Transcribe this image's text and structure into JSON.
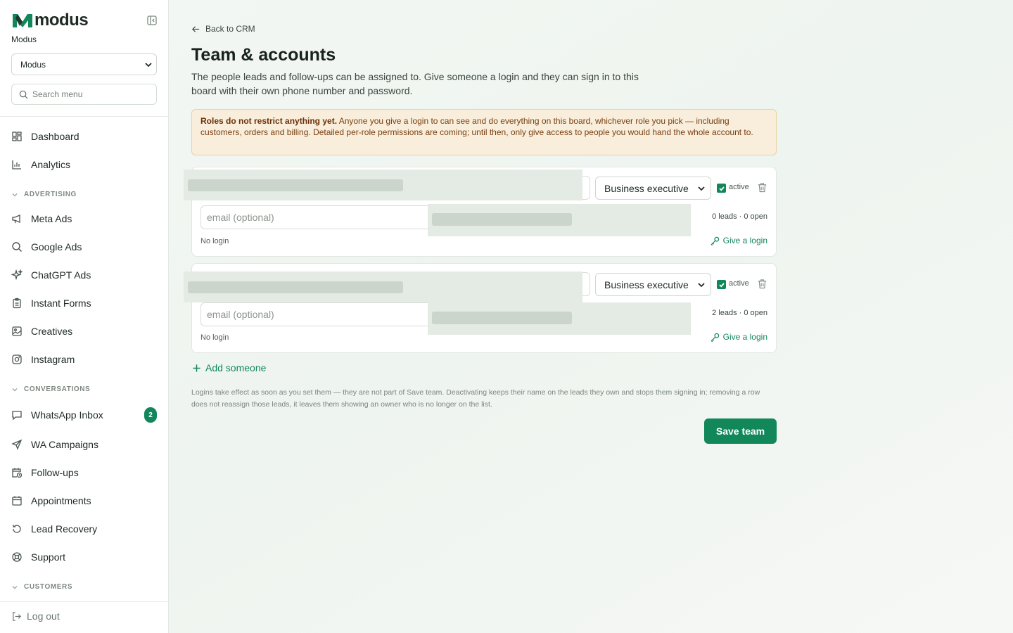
{
  "sidebar": {
    "brand": "modus",
    "org_label": "Modus",
    "org_select_value": "Modus",
    "search_placeholder": "Search menu",
    "items": {
      "dashboard": "Dashboard",
      "analytics": "Analytics",
      "meta_ads": "Meta Ads",
      "google_ads": "Google Ads",
      "chatgpt_ads": "ChatGPT Ads",
      "instant_forms": "Instant Forms",
      "creatives": "Creatives",
      "instagram": "Instagram",
      "whatsapp_inbox": "WhatsApp Inbox",
      "wa_campaigns": "WA Campaigns",
      "follow_ups": "Follow-ups",
      "appointments": "Appointments",
      "lead_recovery": "Lead Recovery",
      "support": "Support"
    },
    "sections": {
      "advertising": "ADVERTISING",
      "conversations": "CONVERSATIONS",
      "customers": "CUSTOMERS"
    },
    "whatsapp_badge": "2",
    "logout": "Log out"
  },
  "main": {
    "back_link": "Back to CRM",
    "title": "Team & accounts",
    "description": "The people leads and follow-ups can be assigned to. Give someone a login and they can sign in to this board with their own phone number and password.",
    "warning_bold": "Roles do not restrict anything yet.",
    "warning_text": " Anyone you give a login to can see and do everything on this board, whichever role you pick — including customers, orders and billing. Detailed per-role permissions are coming; until then, only give access to people you would hand the whole account to.",
    "members": [
      {
        "role": "Business executive",
        "active_label": "active",
        "email_placeholder": "email (optional)",
        "stats": "0 leads · 0 open",
        "login_status": "No login",
        "login_action": "Give a login"
      },
      {
        "role": "Business executive",
        "active_label": "active",
        "email_placeholder": "email (optional)",
        "stats": "2 leads · 0 open",
        "login_status": "No login",
        "login_action": "Give a login"
      }
    ],
    "add_someone": "Add someone",
    "footnote": "Logins take effect as soon as you set them — they are not part of Save team. Deactivating keeps their name on the leads they own and stops them signing in; removing a row does not reassign those leads, it leaves them showing an owner who is no longer on the list.",
    "save_button": "Save team"
  },
  "colors": {
    "accent": "#11875a",
    "warning_bg": "#f8eedb",
    "warning_text": "#7a3e10"
  }
}
